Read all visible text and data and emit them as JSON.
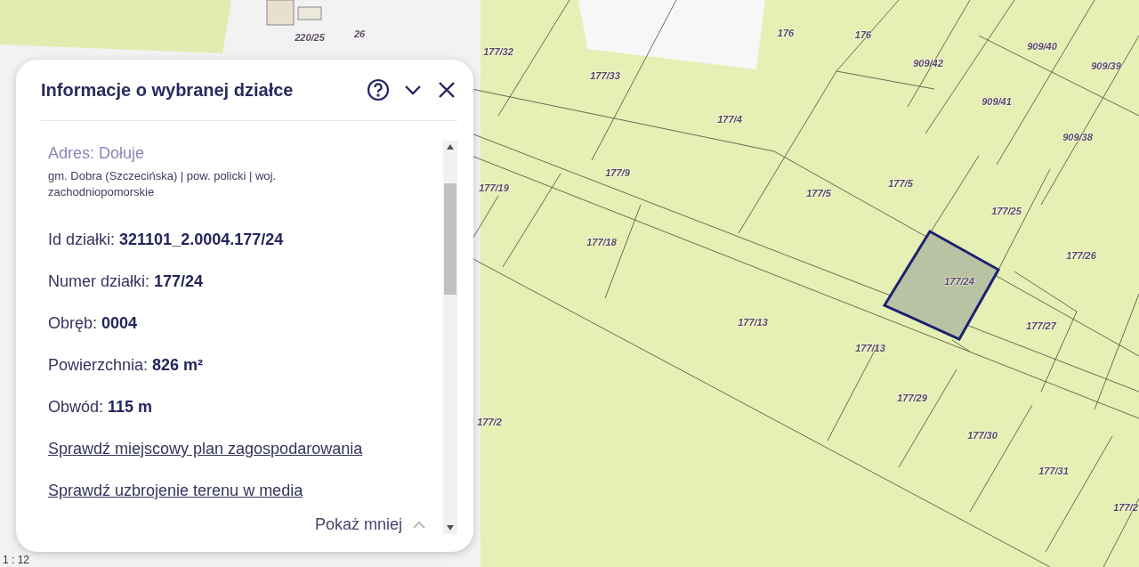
{
  "map": {
    "parcels": [
      "220/25",
      "26",
      "177/32",
      "177/33",
      "176",
      "176",
      "909/42",
      "909/40",
      "909/39",
      "909/41",
      "909/38",
      "177/4",
      "177/9",
      "177/19",
      "177/5",
      "177/5",
      "177/25",
      "177/18",
      "177/26",
      "177/24",
      "177/13",
      "177/13",
      "177/27",
      "177/29",
      "177/30",
      "177/2",
      "177/31",
      "177/2"
    ],
    "scale": "1 : 12"
  },
  "panel": {
    "title": "Informacje o wybranej działce",
    "address": "Adres: Dołuje",
    "region": "gm. Dobra (Szczecińska) | pow. policki | woj. zachodniopomorskie",
    "fields": [
      {
        "label": "Id działki:",
        "value": "321101_2.0004.177/24"
      },
      {
        "label": "Numer działki:",
        "value": "177/24"
      },
      {
        "label": "Obręb:",
        "value": "0004"
      },
      {
        "label": "Powierzchnia:",
        "value": "826 m²"
      },
      {
        "label": "Obwód:",
        "value": "115 m"
      }
    ],
    "links": [
      "Sprawdź miejscowy plan zagospodarowania",
      "Sprawdź uzbrojenie terenu w media"
    ],
    "toggle": "Pokaż mniej"
  }
}
